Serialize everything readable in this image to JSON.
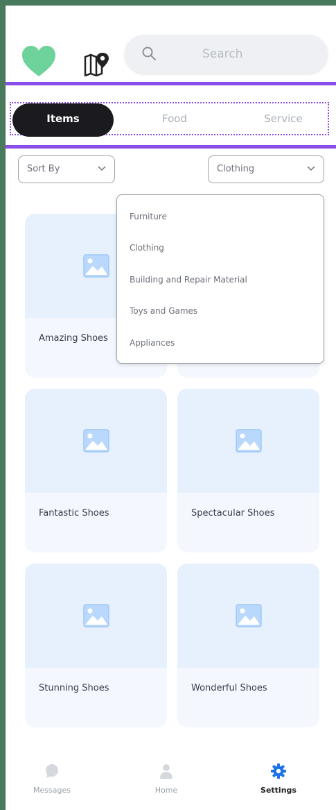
{
  "header": {
    "search_placeholder": "Search"
  },
  "tabs": [
    {
      "label": "Items",
      "active": true
    },
    {
      "label": "Food",
      "active": false
    },
    {
      "label": "Service",
      "active": false
    }
  ],
  "filters": {
    "sort_label": "Sort By",
    "category_selected": "Clothing"
  },
  "category_menu": {
    "options": [
      "Furniture",
      "Clothing",
      "Building and Repair Material",
      "Toys and Games",
      "Appliances"
    ]
  },
  "products": [
    {
      "name": "Amazing Shoes"
    },
    {
      "name": ""
    },
    {
      "name": "Fantastic Shoes"
    },
    {
      "name": "Spectacular Shoes"
    },
    {
      "name": "Stunning Shoes"
    },
    {
      "name": "Wonderful Shoes"
    }
  ],
  "bottom_nav": [
    {
      "label": "Messages",
      "icon": "chat-bubble-icon",
      "active": false
    },
    {
      "label": "Home",
      "icon": "person-icon",
      "active": false
    },
    {
      "label": "Settings",
      "icon": "gear-icon",
      "active": true
    }
  ],
  "colors": {
    "accent": "#8a4ee8",
    "active_tab": "#1b1b1f",
    "logo": "#6ed39a",
    "settings_icon": "#1a73e8",
    "frame": "#4a7a5d"
  }
}
